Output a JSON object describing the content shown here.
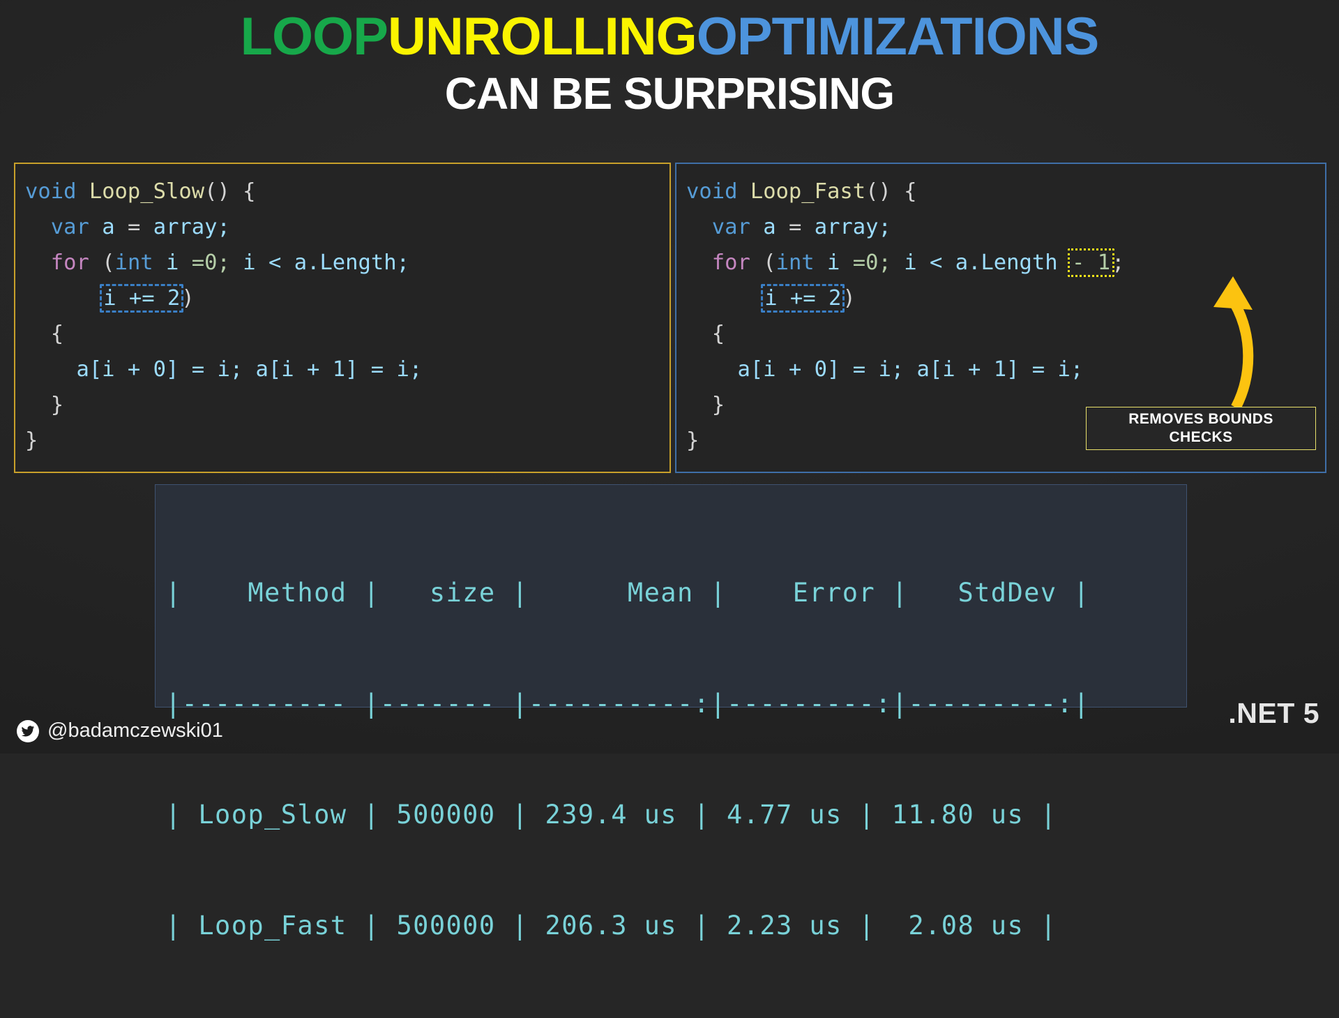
{
  "colors": {
    "background": "#262626",
    "title_green": "#17a84a",
    "title_yellow": "#fbf400",
    "title_blue": "#4d94dd",
    "title_white": "#ffffff",
    "panel_left_border": "#c8a02a",
    "panel_right_border": "#3f6fa8",
    "arrow_yellow": "#fcc310",
    "dashed_blue": "#3a7fc6",
    "dotted_yellow": "#f2e21a",
    "table_text": "#79d2d8",
    "table_background": "#2a303a",
    "table_border": "#3f5270"
  },
  "title": {
    "line1_word1": "LOOP",
    "line1_word2": "UNROLLING",
    "line1_word3": "OPTIMIZATIONS",
    "line2": "CAN BE SURPRISING"
  },
  "code_left": {
    "name": "Loop_Slow",
    "tokens": {
      "kw_void": "void",
      "fn_name": "Loop_Slow",
      "parens": "() {",
      "var_kw": "var",
      "var_a": "a",
      "assign": "=",
      "array": "array;",
      "for_kw": "for",
      "open_paren": "(",
      "int_kw": "int",
      "i": "i",
      "eq_zero": "=0;",
      "cond": "i < a.Length;",
      "increment": "i += 2",
      "close_paren": ")",
      "open_brace": "{",
      "body": "a[i + 0] = i; a[i + 1] = i;",
      "close_brace": "}",
      "end_brace": "}"
    }
  },
  "code_right": {
    "name": "Loop_Fast",
    "tokens": {
      "kw_void": "void",
      "fn_name": "Loop_Fast",
      "parens": "() {",
      "var_kw": "var",
      "var_a": "a",
      "assign": "=",
      "array": "array;",
      "for_kw": "for",
      "open_paren": "(",
      "int_kw": "int",
      "i": "i",
      "eq_zero": "=0;",
      "cond": "i < a.Length",
      "minus_one": "- 1",
      "semicolon": ";",
      "increment": "i += 2",
      "close_paren": ")",
      "open_brace": "{",
      "body": "a[i + 0] = i; a[i + 1] = i;",
      "close_brace": "}",
      "end_brace": "}"
    }
  },
  "callout": {
    "line1": "REMOVES BOUNDS",
    "line2": "CHECKS"
  },
  "benchmark": {
    "header_row": "|    Method |   size |      Mean |    Error |   StdDev |",
    "separator_row": "|---------- |------- |----------:|---------:|---------:|",
    "row1": "| Loop_Slow | 500000 | 239.4 us | 4.77 us | 11.80 us |",
    "row2": "| Loop_Fast | 500000 | 206.3 us | 2.23 us |  2.08 us |",
    "columns": [
      "Method",
      "size",
      "Mean",
      "Error",
      "StdDev"
    ],
    "rows": [
      {
        "Method": "Loop_Slow",
        "size": "500000",
        "Mean": "239.4 us",
        "Error": "4.77 us",
        "StdDev": "11.80 us"
      },
      {
        "Method": "Loop_Fast",
        "size": "500000",
        "Mean": "206.3 us",
        "Error": "2.23 us",
        "StdDev": "2.08 us"
      }
    ]
  },
  "footer": {
    "twitter_handle": "@badamczewski01",
    "platform_badge": ".NET 5"
  }
}
